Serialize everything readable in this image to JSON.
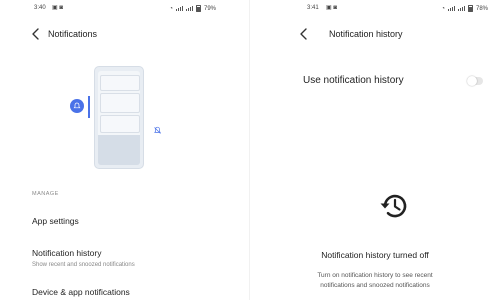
{
  "left": {
    "status": {
      "time": "3:40",
      "battery": "79%"
    },
    "title": "Notifications",
    "section_header": "MANAGE",
    "items": [
      {
        "label": "App settings"
      },
      {
        "label": "Notification history",
        "subtitle": "Show recent and snoozed notifications"
      },
      {
        "label": "Device & app notifications"
      }
    ]
  },
  "right": {
    "status": {
      "time": "3:41",
      "battery": "78%"
    },
    "title": "Notification history",
    "toggle_label": "Use notification history",
    "toggle_on": false,
    "empty_title": "Notification history turned off",
    "empty_desc_line1": "Turn on notification history to see recent",
    "empty_desc_line2": "notifications and snoozed notifications"
  },
  "colors": {
    "accent": "#4a72e8",
    "text": "#1f1f1f",
    "secondary": "#888888"
  },
  "icons": [
    "back-arrow-icon",
    "history-icon",
    "bell-icon",
    "mute-bell-icon",
    "battery-icon",
    "signal-icon"
  ]
}
